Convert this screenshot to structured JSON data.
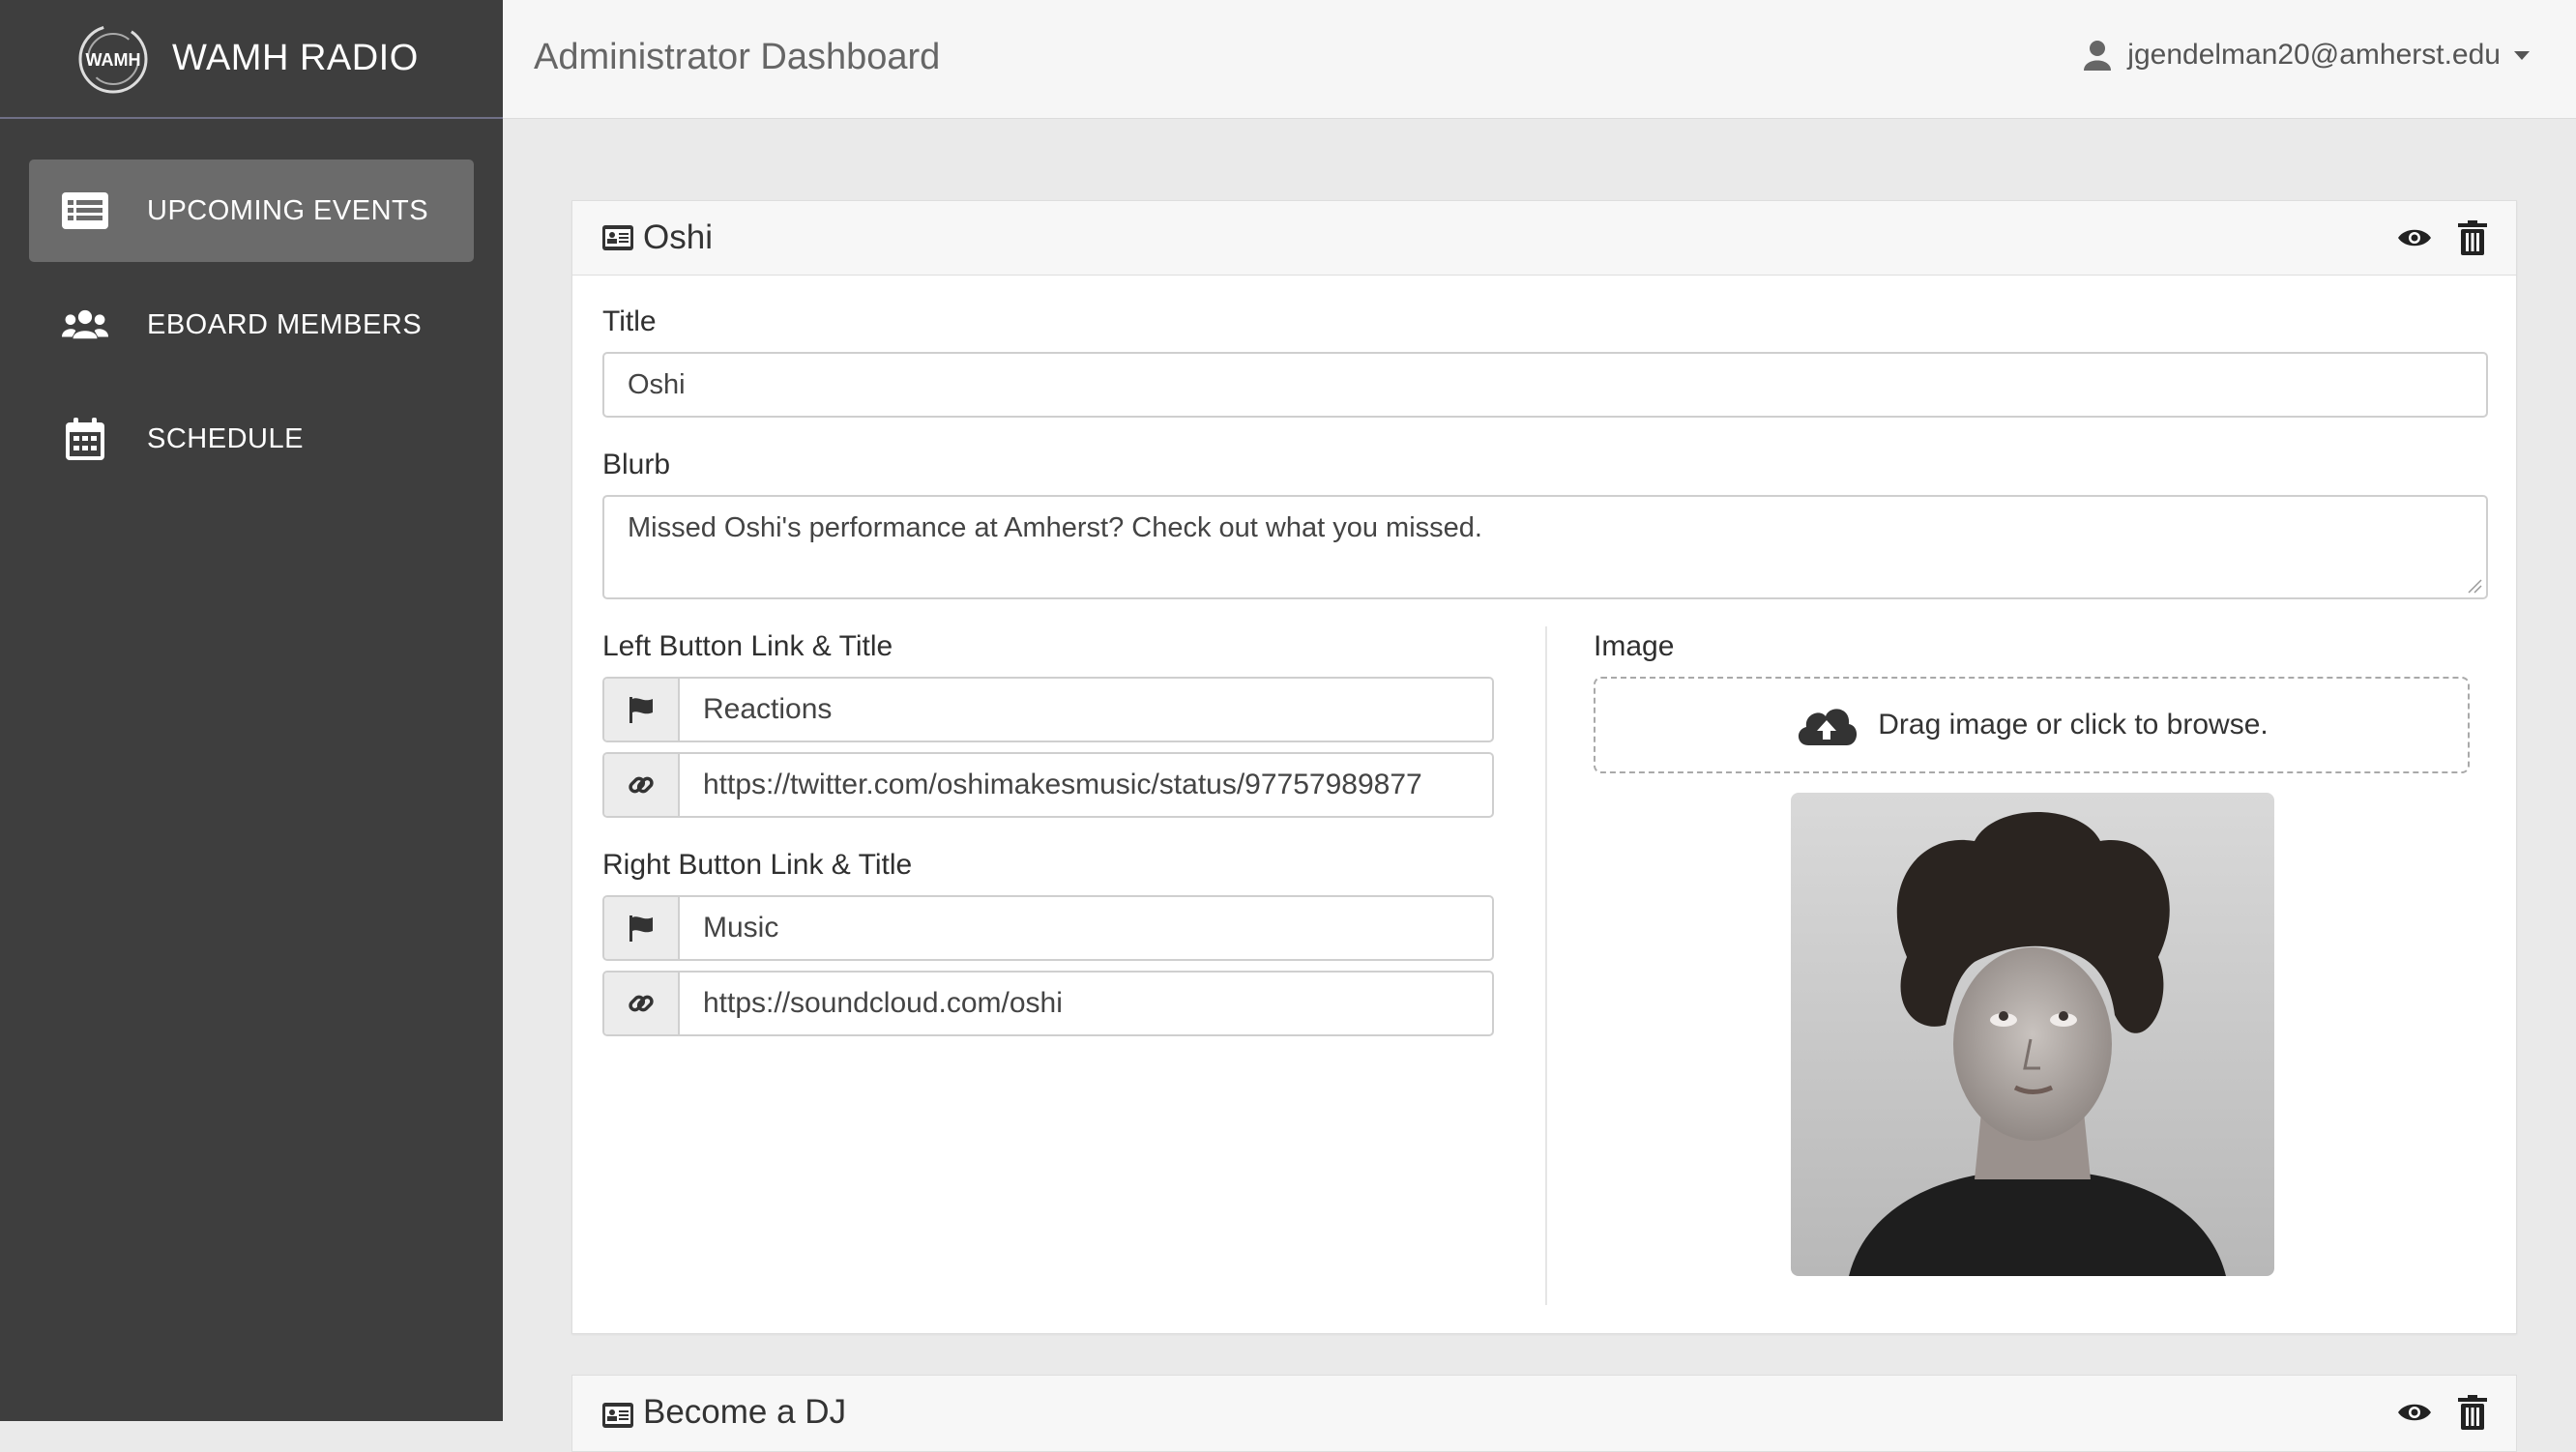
{
  "brand": {
    "name": "WAMH RADIO",
    "logo_text": "WAMH"
  },
  "sidebar": {
    "items": [
      {
        "label": "UPCOMING EVENTS",
        "icon": "list-alt-icon",
        "active": true
      },
      {
        "label": "EBOARD MEMBERS",
        "icon": "users-icon",
        "active": false
      },
      {
        "label": "SCHEDULE",
        "icon": "calendar-icon",
        "active": false
      }
    ]
  },
  "header": {
    "title": "Administrator Dashboard",
    "user": "jgendelman20@amherst.edu"
  },
  "events": [
    {
      "name": "Oshi",
      "fields": {
        "title_label": "Title",
        "title_value": "Oshi",
        "blurb_label": "Blurb",
        "blurb_value": "Missed Oshi's performance at Amherst? Check out what you missed.",
        "left_label": "Left Button Link & Title",
        "left_title": "Reactions",
        "left_link": "https://twitter.com/oshimakesmusic/status/97757989877",
        "right_label": "Right Button Link & Title",
        "right_title": "Music",
        "right_link": "https://soundcloud.com/oshi",
        "image_label": "Image",
        "dropzone_text": "Drag image or click to browse."
      }
    },
    {
      "name": "Become a DJ"
    }
  ],
  "colors": {
    "sidebar": "#3e3e3e",
    "active_item": "#6b6b6b",
    "brand_rule": "#6f6f86"
  }
}
